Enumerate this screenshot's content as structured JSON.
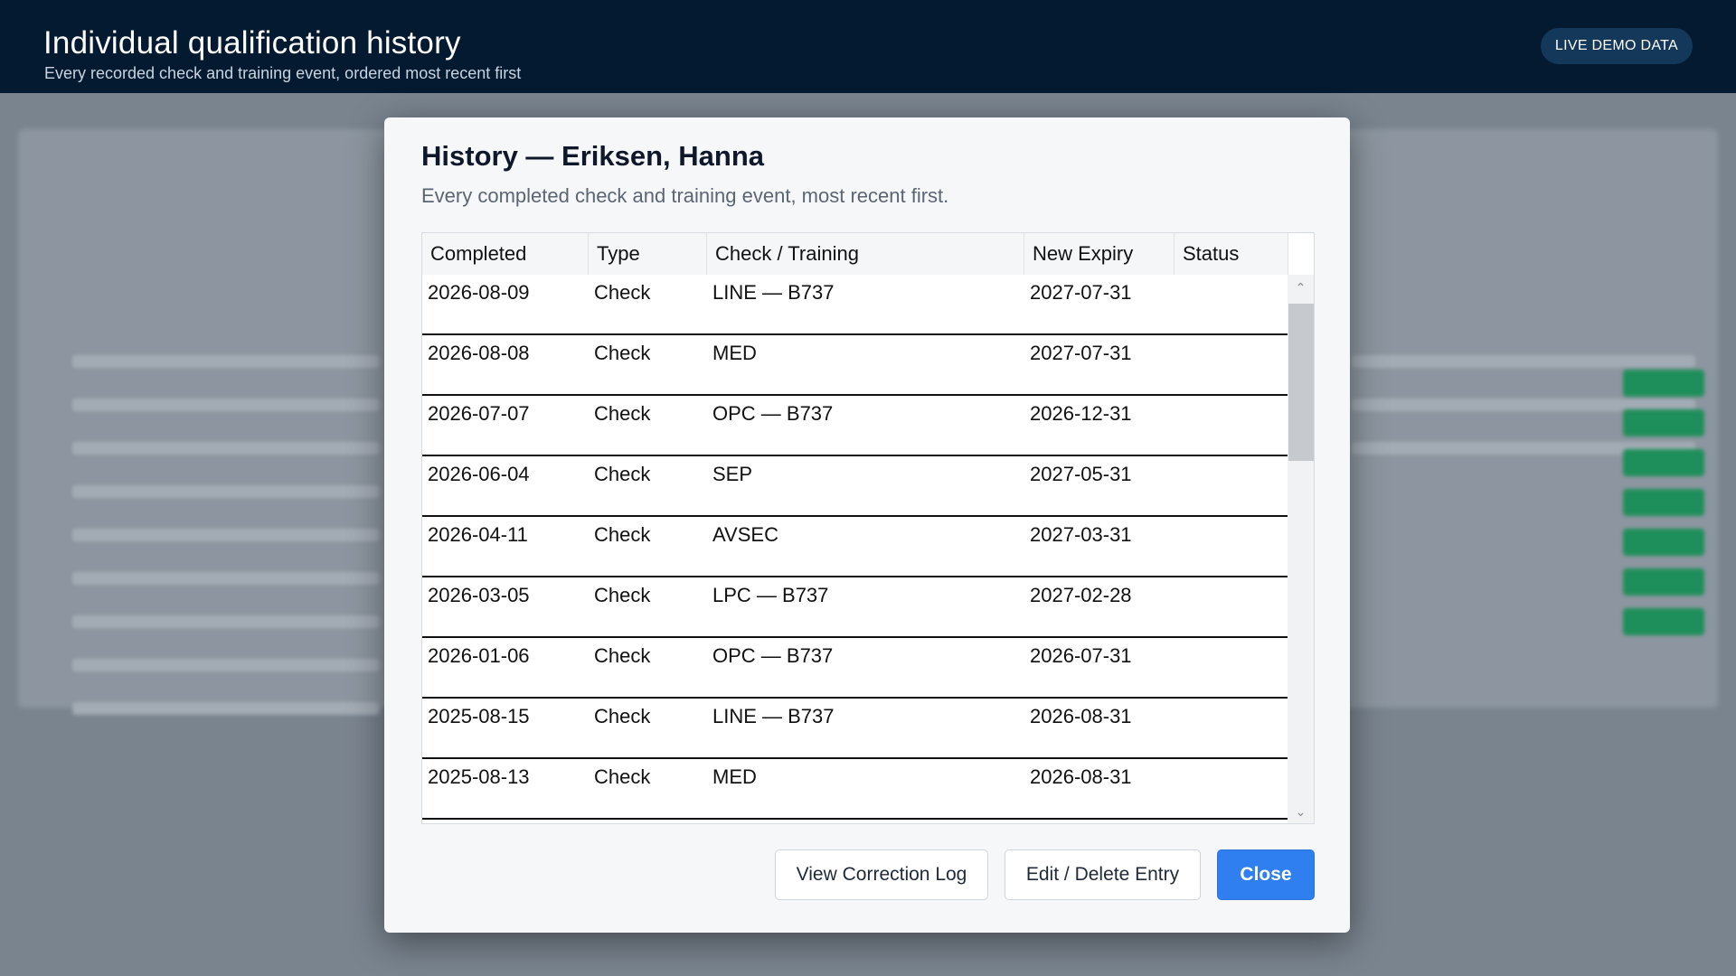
{
  "header": {
    "title": "Individual qualification history",
    "subtitle": "Every recorded check and training event, ordered most recent first",
    "badge": "LIVE DEMO DATA"
  },
  "modal": {
    "title": "History — Eriksen, Hanna",
    "subtitle": "Every completed check and training event, most recent first.",
    "columns": [
      "Completed",
      "Type",
      "Check / Training",
      "New Expiry",
      "Status"
    ],
    "rows": [
      {
        "completed": "2026-08-09",
        "type": "Check",
        "check": "LINE — B737",
        "expiry": "2027-07-31",
        "status": ""
      },
      {
        "completed": "2026-08-08",
        "type": "Check",
        "check": "MED",
        "expiry": "2027-07-31",
        "status": ""
      },
      {
        "completed": "2026-07-07",
        "type": "Check",
        "check": "OPC — B737",
        "expiry": "2026-12-31",
        "status": ""
      },
      {
        "completed": "2026-06-04",
        "type": "Check",
        "check": "SEP",
        "expiry": "2027-05-31",
        "status": ""
      },
      {
        "completed": "2026-04-11",
        "type": "Check",
        "check": "AVSEC",
        "expiry": "2027-03-31",
        "status": ""
      },
      {
        "completed": "2026-03-05",
        "type": "Check",
        "check": "LPC — B737",
        "expiry": "2027-02-28",
        "status": ""
      },
      {
        "completed": "2026-01-06",
        "type": "Check",
        "check": "OPC — B737",
        "expiry": "2026-07-31",
        "status": ""
      },
      {
        "completed": "2025-08-15",
        "type": "Check",
        "check": "LINE — B737",
        "expiry": "2026-08-31",
        "status": ""
      },
      {
        "completed": "2025-08-13",
        "type": "Check",
        "check": "MED",
        "expiry": "2026-08-31",
        "status": ""
      }
    ],
    "buttons": {
      "view_log": "View Correction Log",
      "edit_delete": "Edit / Delete Entry",
      "close": "Close"
    }
  },
  "colors": {
    "header_bg": "#041a31",
    "primary_button": "#2f7ff0",
    "badge_bg": "#14385a"
  }
}
